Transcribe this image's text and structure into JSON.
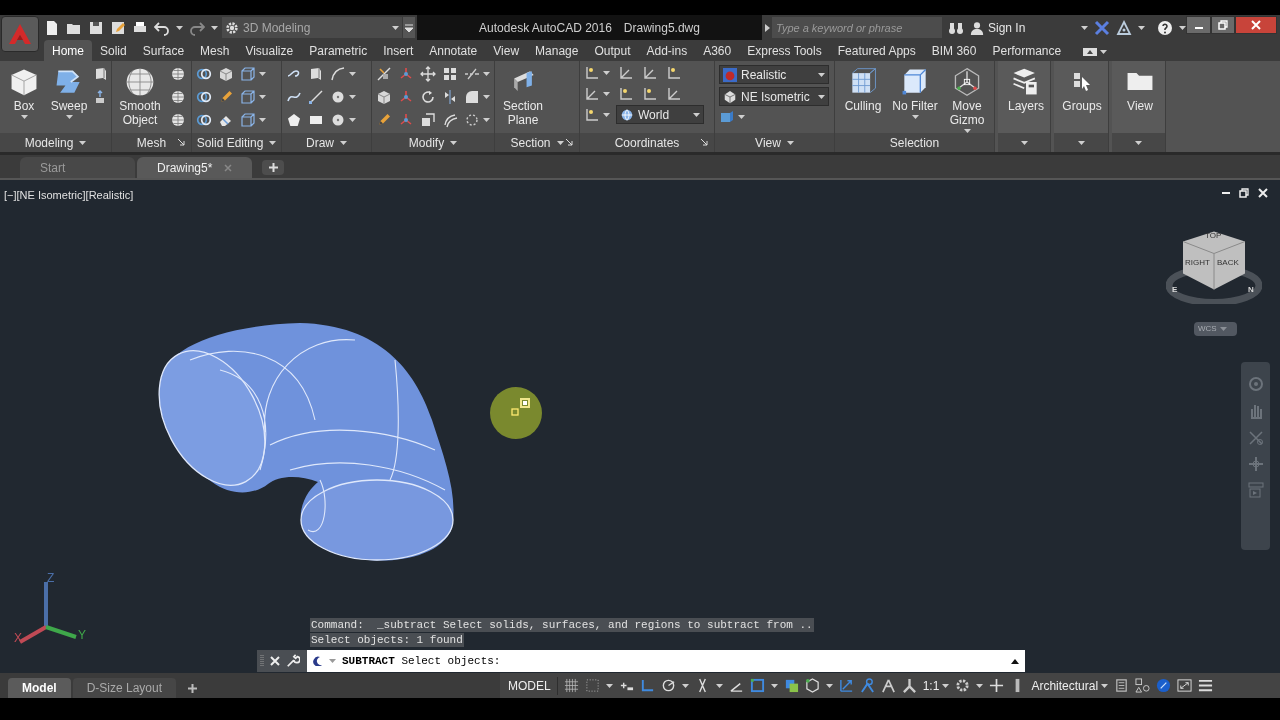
{
  "title_bar": {
    "workspace": "3D Modeling",
    "app_title": "Autodesk AutoCAD 2016",
    "file_name": "Drawing5.dwg",
    "search": {
      "placeholder": "Type a keyword or phrase"
    },
    "sign_in": "Sign In"
  },
  "ribbon_tabs": [
    {
      "label": "Home",
      "selected": true
    },
    {
      "label": "Solid",
      "selected": false
    },
    {
      "label": "Surface",
      "selected": false
    },
    {
      "label": "Mesh",
      "selected": false
    },
    {
      "label": "Visualize",
      "selected": false
    },
    {
      "label": "Parametric",
      "selected": false
    },
    {
      "label": "Insert",
      "selected": false
    },
    {
      "label": "Annotate",
      "selected": false
    },
    {
      "label": "View",
      "selected": false
    },
    {
      "label": "Manage",
      "selected": false
    },
    {
      "label": "Output",
      "selected": false
    },
    {
      "label": "Add-ins",
      "selected": false
    },
    {
      "label": "A360",
      "selected": false
    },
    {
      "label": "Express Tools",
      "selected": false
    },
    {
      "label": "Featured Apps",
      "selected": false
    },
    {
      "label": "BIM 360",
      "selected": false
    },
    {
      "label": "Performance",
      "selected": false
    }
  ],
  "panels": [
    {
      "title": "Modeling",
      "dropdown": true,
      "launcher": false,
      "large_buttons": [
        {
          "label": "Box",
          "dropdown": true
        },
        {
          "label": "Sweep",
          "dropdown": true
        }
      ]
    },
    {
      "title": "Mesh",
      "dropdown": false,
      "launcher": true,
      "large_buttons": [
        {
          "label": "Smooth Object",
          "dropdown": false
        }
      ]
    },
    {
      "title": "Solid Editing",
      "dropdown": true,
      "launcher": false
    },
    {
      "title": "Draw",
      "dropdown": true,
      "launcher": false
    },
    {
      "title": "Modify",
      "dropdown": true,
      "launcher": false
    },
    {
      "title": "Section",
      "dropdown": true,
      "launcher": true,
      "large_buttons": [
        {
          "label": "Section Plane",
          "dropdown": false
        }
      ]
    },
    {
      "title": "Coordinates",
      "dropdown": false,
      "launcher": true,
      "combos": [
        "World"
      ]
    },
    {
      "title": "View",
      "dropdown": true,
      "launcher": false,
      "combos": [
        "Realistic",
        "NE Isometric"
      ]
    },
    {
      "title": "Selection",
      "dropdown": false,
      "launcher": false,
      "large_buttons": [
        {
          "label": "Culling",
          "dropdown": false
        },
        {
          "label": "No Filter",
          "dropdown": true
        },
        {
          "label": "Move Gizmo",
          "dropdown": true
        }
      ]
    },
    {
      "dropdown": true,
      "launcher": false,
      "large_buttons": [
        {
          "label": "Layers",
          "dropdown": false
        }
      ]
    },
    {
      "dropdown": true,
      "launcher": false,
      "large_buttons": [
        {
          "label": "Groups",
          "dropdown": false
        }
      ]
    },
    {
      "dropdown": true,
      "launcher": false,
      "large_buttons": [
        {
          "label": "View",
          "dropdown": false
        }
      ]
    }
  ],
  "document_tabs": [
    {
      "label": "Start",
      "selected": false
    },
    {
      "label": "Drawing5*",
      "selected": true
    }
  ],
  "viewport": {
    "label": "[−][NE Isometric][Realistic]",
    "viewcube": {
      "faces": [
        "TOP",
        "RIGHT",
        "BACK"
      ],
      "compass": [
        "E",
        "N"
      ]
    },
    "ucs_menu": "WCS",
    "axes": [
      "X",
      "Y",
      "Z"
    ]
  },
  "command": {
    "history": [
      "Command:  _subtract Select solids, surfaces, and regions to subtract from ..",
      "Select objects: 1 found"
    ],
    "prompt": "**SUBTRACT** Select objects:"
  },
  "layout_tabs": [
    {
      "label": "Model",
      "selected": true
    },
    {
      "label": "D-Size Layout",
      "selected": false
    }
  ],
  "status_bar": {
    "space": "MODEL",
    "scale": "1:1",
    "units": "Architectural"
  }
}
